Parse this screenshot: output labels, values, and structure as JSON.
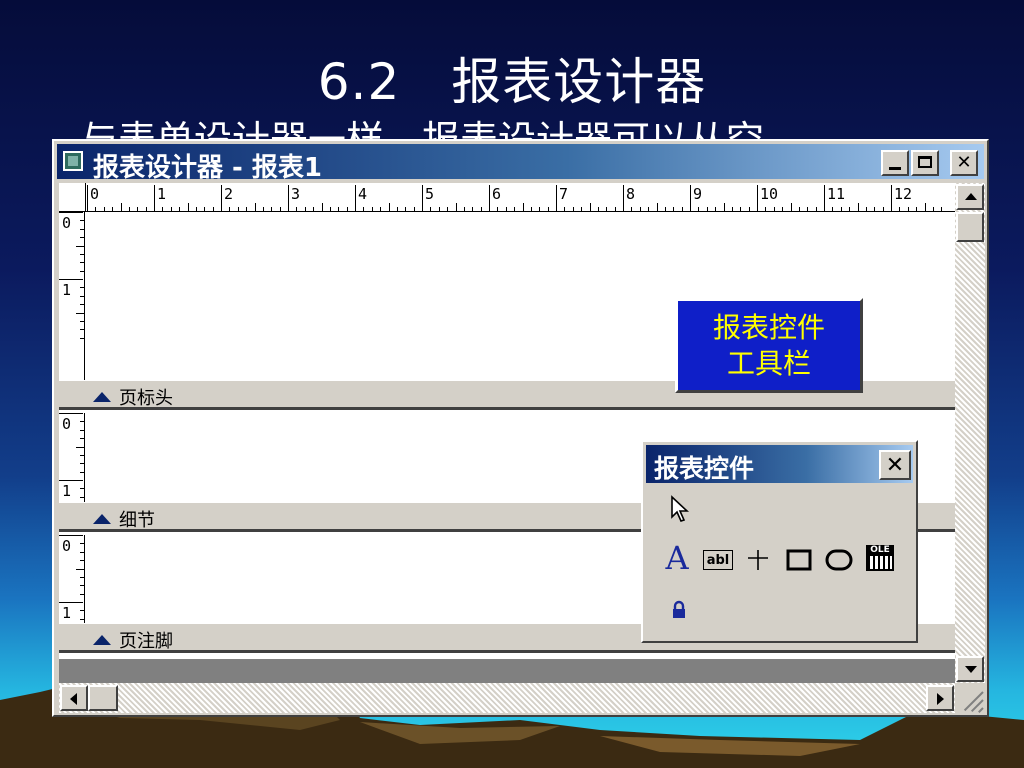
{
  "slide": {
    "title": "6.2　报表设计器",
    "subtitle": "与表单设计器一样，报表设计器可以从空"
  },
  "window": {
    "title": "报表设计器 - 报表1",
    "min_label": "",
    "max_label": "",
    "close_label": "✕"
  },
  "ruler": {
    "h_numbers": [
      "0",
      "1",
      "2",
      "3",
      "4",
      "5",
      "6",
      "7",
      "8",
      "9",
      "10",
      "11",
      "12"
    ],
    "v_numbers": [
      "0",
      "1"
    ]
  },
  "bands": [
    {
      "label": "页标头"
    },
    {
      "label": "细节"
    },
    {
      "label": "页注脚"
    }
  ],
  "callout": {
    "line1": "报表控件",
    "line2": "工具栏"
  },
  "toolbox": {
    "title": "报表控件",
    "close_label": "✕",
    "tools": [
      {
        "name": "pointer",
        "icon": "arrow-pointer-icon"
      },
      {
        "name": "label",
        "icon": "label-A-icon",
        "text": "A"
      },
      {
        "name": "field",
        "icon": "field-ab-icon",
        "text": "abl"
      },
      {
        "name": "line",
        "icon": "line-icon"
      },
      {
        "name": "rectangle",
        "icon": "rectangle-icon"
      },
      {
        "name": "rounded-rectangle",
        "icon": "rounded-rectangle-icon"
      },
      {
        "name": "ole-picture",
        "icon": "ole-picture-icon",
        "text": "OLE"
      },
      {
        "name": "lock",
        "icon": "lock-icon"
      }
    ]
  },
  "colors": {
    "titlebar": "#0a246a",
    "callout_bg": "#0f1fc8",
    "callout_text": "#ffff00",
    "tool_blue": "#1a2a9c"
  }
}
